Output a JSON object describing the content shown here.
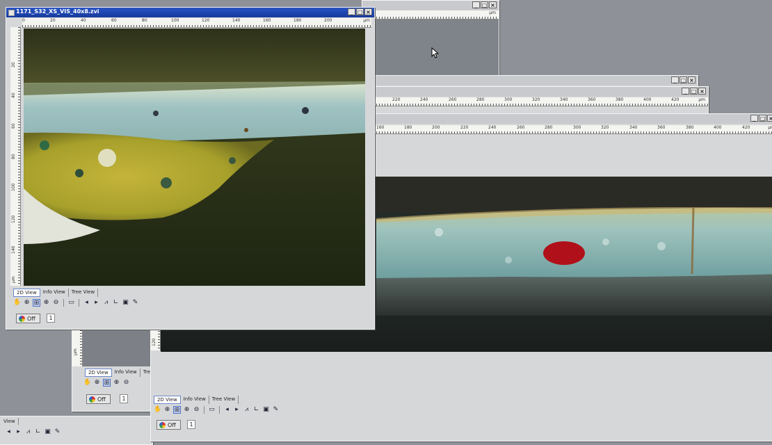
{
  "main_window": {
    "title": "1171_S32_XS_VIS_40x8.zvi",
    "ruler_ticks": [
      "0",
      "20",
      "40",
      "60",
      "80",
      "100",
      "120",
      "140",
      "160",
      "180",
      "200"
    ],
    "ruler_unit": "µm",
    "vruler_ticks": [
      "20",
      "40",
      "60",
      "80",
      "100",
      "120",
      "140",
      "µm"
    ],
    "tabs": [
      "2D View",
      "Info View",
      "Tree View"
    ],
    "off_label": "Off",
    "channel_value": "1"
  },
  "right_window_a": {
    "ruler_ticks": [
      "220",
      "240",
      "260",
      "280",
      "300",
      "320",
      "340",
      "360",
      "380",
      "400",
      "420"
    ],
    "ruler_unit": "µm"
  },
  "right_window_b": {
    "ruler_ticks": [
      "160",
      "180",
      "200",
      "220",
      "240",
      "260",
      "280",
      "300",
      "320",
      "340",
      "360",
      "380",
      "400",
      "420"
    ],
    "ruler_unit": "µm",
    "vruler_ticks": [
      "120",
      "µm"
    ],
    "tabs": [
      "2D View",
      "Info View",
      "Tree View"
    ],
    "off_label": "Off",
    "channel_value": "1"
  },
  "back_window": {
    "ruler_unit": "µm"
  },
  "mid_window": {
    "tabs": [
      "2D View",
      "Info View",
      "Tre"
    ],
    "off_label": "Off",
    "channel_value": "1",
    "vruler_ticks": [
      "µm"
    ]
  },
  "bottom_left_window": {
    "tabs": [
      "View"
    ]
  },
  "controls": {
    "minimize": "_",
    "maximize": "□",
    "close": "×"
  }
}
